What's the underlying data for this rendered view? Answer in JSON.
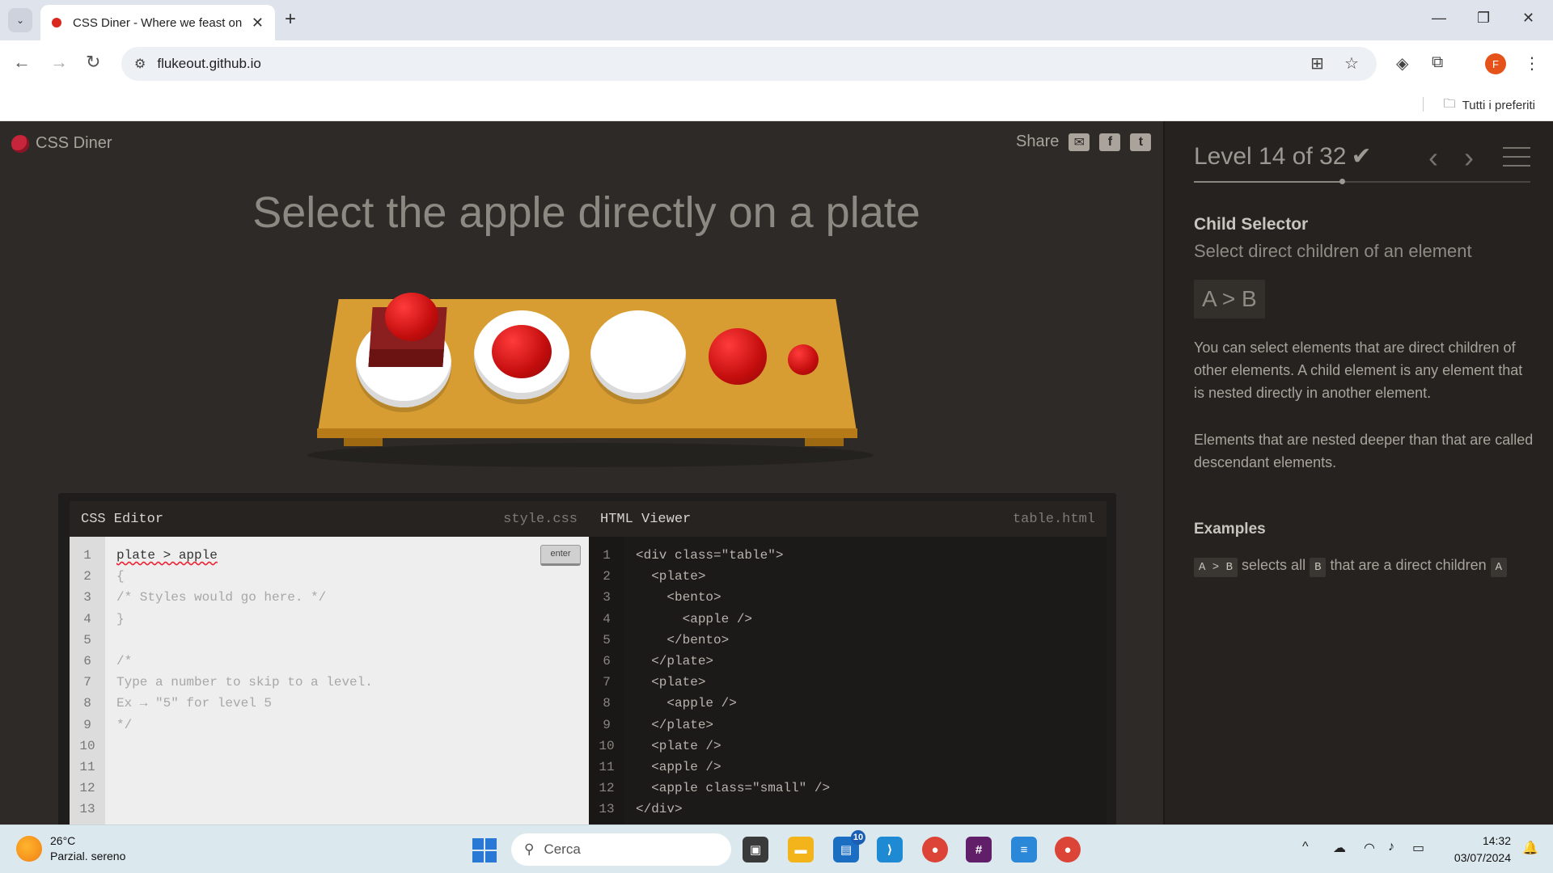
{
  "browser": {
    "tab_title": "CSS Diner - Where we feast on CSS selectors!",
    "new_tab": "+",
    "url": "flukeout.github.io",
    "bookmarks_label": "Tutti i preferiti",
    "profile_initial": "F"
  },
  "header": {
    "logo": "CSS Diner",
    "share_label": "Share"
  },
  "instruction": "Select the apple directly on a plate",
  "editor": {
    "css_title": "CSS Editor",
    "css_file": "style.css",
    "enter_label": "enter",
    "css_lines": [
      "plate > apple",
      "{",
      "/* Styles would go here. */",
      "}",
      "",
      "/*",
      "Type a number to skip to a level.",
      "Ex → \"5\" for level 5",
      "*/",
      "",
      "",
      ""
    ],
    "html_title": "HTML Viewer",
    "html_file": "table.html",
    "html_lines": [
      "<div class=\"table\">",
      "  <plate>",
      "    <bento>",
      "      <apple />",
      "    </bento>",
      "  </plate>",
      "  <plate>",
      "    <apple />",
      "  </plate>",
      "  <plate />",
      "  <apple />",
      "  <apple class=\"small\" />",
      "</div>"
    ],
    "line_numbers": [
      "1",
      "2",
      "3",
      "4",
      "5",
      "6",
      "7",
      "8",
      "9",
      "10",
      "11",
      "12",
      "13"
    ]
  },
  "sidebar": {
    "level_title": "Level 14 of 32",
    "level_progress": 0.44,
    "selector_name": "Child Selector",
    "selector_title": "Select direct children of an element",
    "syntax": "A > B",
    "hint_1": "You can select elements that are direct children of other elements. A child element is any element that is nested directly in another element.",
    "hint_2": "Elements that are nested deeper than that are called descendant elements.",
    "examples_heading": "Examples",
    "example_code": "A > B",
    "example_text_1": "selects all",
    "example_tag_b": "B",
    "example_text_2": "that are a direct children",
    "example_tag_a": "A"
  },
  "taskbar": {
    "temperature": "26°C",
    "weather": "Parzial. sereno",
    "search_placeholder": "Cerca",
    "notification_badge": "10",
    "time": "14:32",
    "date": "03/07/2024"
  }
}
